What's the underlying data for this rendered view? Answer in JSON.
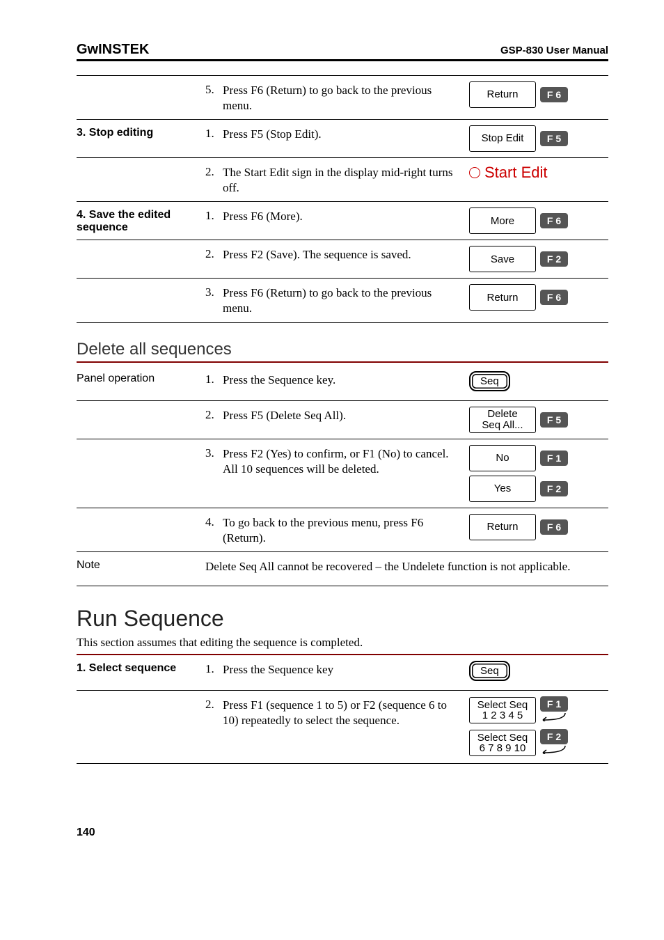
{
  "header": {
    "logo": "GᴡINSTEK",
    "manual": "GSP-830 User Manual"
  },
  "block1": {
    "rows": [
      {
        "left": "",
        "num": "5.",
        "desc": "Press F6 (Return) to go back to the previous menu.",
        "sk": {
          "label": "Return",
          "f": "F 6"
        }
      },
      {
        "left": "3. Stop editing",
        "num": "1.",
        "desc": "Press F5 (Stop Edit).",
        "sk": {
          "label": "Stop Edit",
          "f": "F 5"
        }
      },
      {
        "left": "",
        "num": "2.",
        "desc": "The Start Edit sign in the display mid-right turns off.",
        "start_edit": "Start Edit"
      },
      {
        "left": "4. Save the edited sequence",
        "num": "1.",
        "desc": "Press F6 (More).",
        "sk": {
          "label": "More",
          "f": "F 6"
        }
      },
      {
        "left": "",
        "num": "2.",
        "desc": "Press F2 (Save). The sequence is saved.",
        "sk": {
          "label": "Save",
          "f": "F 2"
        }
      },
      {
        "left": "",
        "num": "3.",
        "desc": "Press F6 (Return) to go back to the previous menu.",
        "sk": {
          "label": "Return",
          "f": "F 6"
        }
      }
    ]
  },
  "delete_section": {
    "heading": "Delete all sequences",
    "panel_label": "Panel operation",
    "rows": [
      {
        "num": "1.",
        "desc": "Press the Sequence key.",
        "hardkey": "Seq"
      },
      {
        "num": "2.",
        "desc": "Press F5 (Delete Seq All).",
        "sk": {
          "label_lines": [
            "Delete",
            "Seq All..."
          ],
          "f": "F 5"
        }
      },
      {
        "num": "3.",
        "desc": "Press F2 (Yes) to confirm, or F1 (No) to cancel. All 10 sequences will be deleted.",
        "sk_multi": [
          {
            "label": "No",
            "f": "F 1"
          },
          {
            "label": "Yes",
            "f": "F 2"
          }
        ]
      },
      {
        "num": "4.",
        "desc": "To go back to the previous menu, press F6 (Return).",
        "sk": {
          "label": "Return",
          "f": "F 6"
        }
      }
    ],
    "note_label": "Note",
    "note_text": "Delete Seq All cannot be recovered – the Undelete function is not applicable."
  },
  "run_section": {
    "heading": "Run Sequence",
    "intro": "This section assumes that editing the sequence is completed.",
    "rows": [
      {
        "left": "1. Select sequence",
        "num": "1.",
        "desc": "Press the Sequence key",
        "hardkey": "Seq"
      },
      {
        "left": "",
        "num": "2.",
        "desc": "Press F1 (sequence 1 to 5) or F2 (sequence 6 to 10) repeatedly to select the sequence.",
        "sk_multi_cycle": [
          {
            "label_lines": [
              "Select Seq",
              "1 2 3 4 5"
            ],
            "f": "F 1"
          },
          {
            "label_lines": [
              "Select Seq",
              "6 7 8 9 10"
            ],
            "f": "F 2"
          }
        ]
      }
    ]
  },
  "page_number": "140"
}
